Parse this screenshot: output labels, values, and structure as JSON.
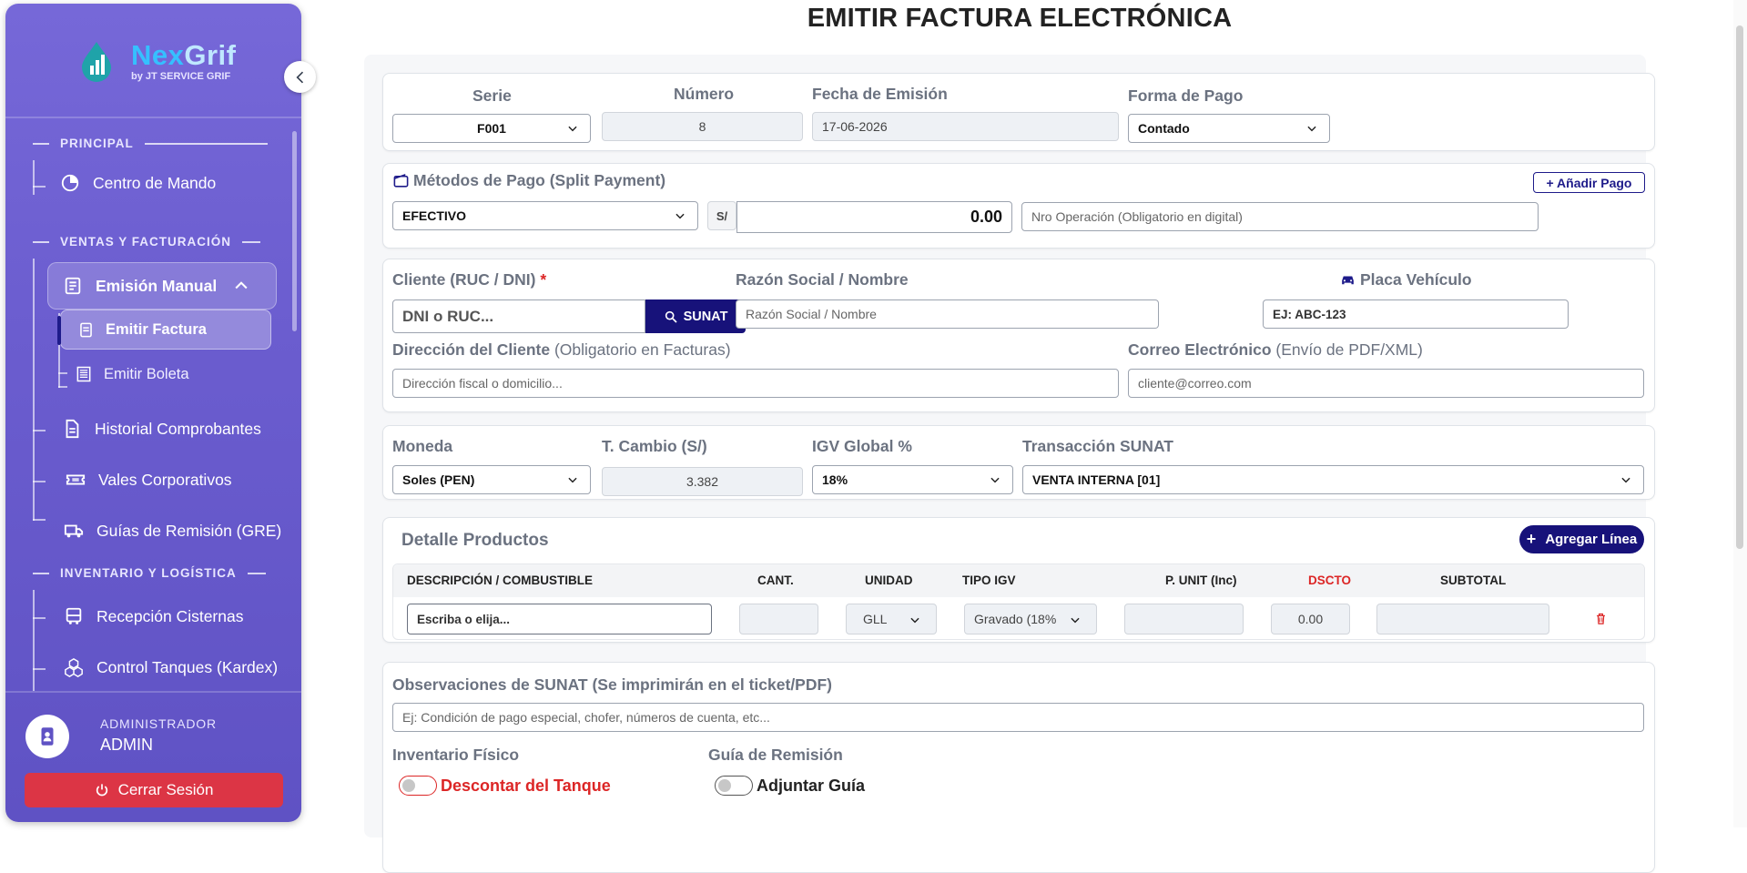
{
  "brand": {
    "name_a": "Nex",
    "name_b": "Grif",
    "subtitle": "by JT SERVICE GRIF"
  },
  "sidebar": {
    "sections": {
      "principal": "PRINCIPAL",
      "ventas": "VENTAS Y FACTURACIÓN",
      "inventario": "INVENTARIO Y LOGÍSTICA"
    },
    "items": {
      "centro": "Centro de Mando",
      "emision": "Emisión Manual",
      "emitir_factura": "Emitir Factura",
      "emitir_boleta": "Emitir Boleta",
      "historial": "Historial Comprobantes",
      "vales": "Vales Corporativos",
      "guias": "Guías de Remisión (GRE)",
      "recepcion": "Recepción Cisternas",
      "tanques": "Control Tanques (Kardex)"
    },
    "user": {
      "role": "ADMINISTRADOR",
      "name": "ADMIN"
    },
    "logout": "Cerrar Sesión"
  },
  "page": {
    "title": "EMITIR FACTURA ELECTRÓNICA"
  },
  "header_fields": {
    "serie_label": "Serie",
    "serie_value": "F001",
    "numero_label": "Número",
    "numero_value": "8",
    "fecha_label": "Fecha de Emisión",
    "fecha_value": "17-06-2026",
    "forma_label": "Forma de Pago",
    "forma_value": "Contado"
  },
  "payments": {
    "title": "Métodos de Pago (Split Payment)",
    "add_button": "+ Añadir Pago",
    "method": "EFECTIVO",
    "currency_symbol": "S/",
    "amount": "0.00",
    "operation_placeholder": "Nro Operación (Obligatorio en digital)"
  },
  "client": {
    "doc_label": "Cliente (RUC / DNI)",
    "required_mark": "*",
    "doc_placeholder": "DNI o RUC...",
    "sunat_button": "SUNAT",
    "razon_label": "Razón Social / Nombre",
    "razon_placeholder": "Razón Social / Nombre",
    "placa_label": "Placa Vehículo",
    "placa_placeholder": "EJ: ABC-123",
    "direccion_label": "Dirección del Cliente",
    "direccion_hint": "(Obligatorio en Facturas)",
    "direccion_placeholder": "Dirección fiscal o domicilio...",
    "correo_label": "Correo Electrónico",
    "correo_hint": "(Envío de PDF/XML)",
    "correo_placeholder": "cliente@correo.com"
  },
  "currency": {
    "moneda_label": "Moneda",
    "moneda_value": "Soles (PEN)",
    "tc_label": "T. Cambio (S/)",
    "tc_value": "3.382",
    "igv_label": "IGV Global %",
    "igv_value": "18%",
    "trans_label": "Transacción SUNAT",
    "trans_value": "VENTA INTERNA [01]"
  },
  "products": {
    "title": "Detalle Productos",
    "add_button": "Agregar Línea",
    "columns": {
      "desc": "DESCRIPCIÓN / COMBUSTIBLE",
      "cant": "CANT.",
      "unidad": "UNIDAD",
      "tipo": "TIPO IGV",
      "punit": "P. UNIT (Inc)",
      "dscto": "DSCTO",
      "subtotal": "SUBTOTAL"
    },
    "row": {
      "desc_placeholder": "Escriba o elija...",
      "unidad": "GLL",
      "tipo": "Gravado (18%",
      "dscto": "0.00"
    }
  },
  "observations": {
    "label": "Observaciones de SUNAT (Se imprimirán en el ticket/PDF)",
    "placeholder": "Ej: Condición de pago especial, chofer, números de cuenta, etc..."
  },
  "toggles": {
    "inventario_label": "Inventario Físico",
    "inventario_toggle": "Descontar del Tanque",
    "guia_label": "Guía de Remisión",
    "guia_toggle": "Adjuntar Guía"
  },
  "colors": {
    "sidebar": "#6b5dcf",
    "primary": "#17127a",
    "danger": "#dc3545"
  }
}
